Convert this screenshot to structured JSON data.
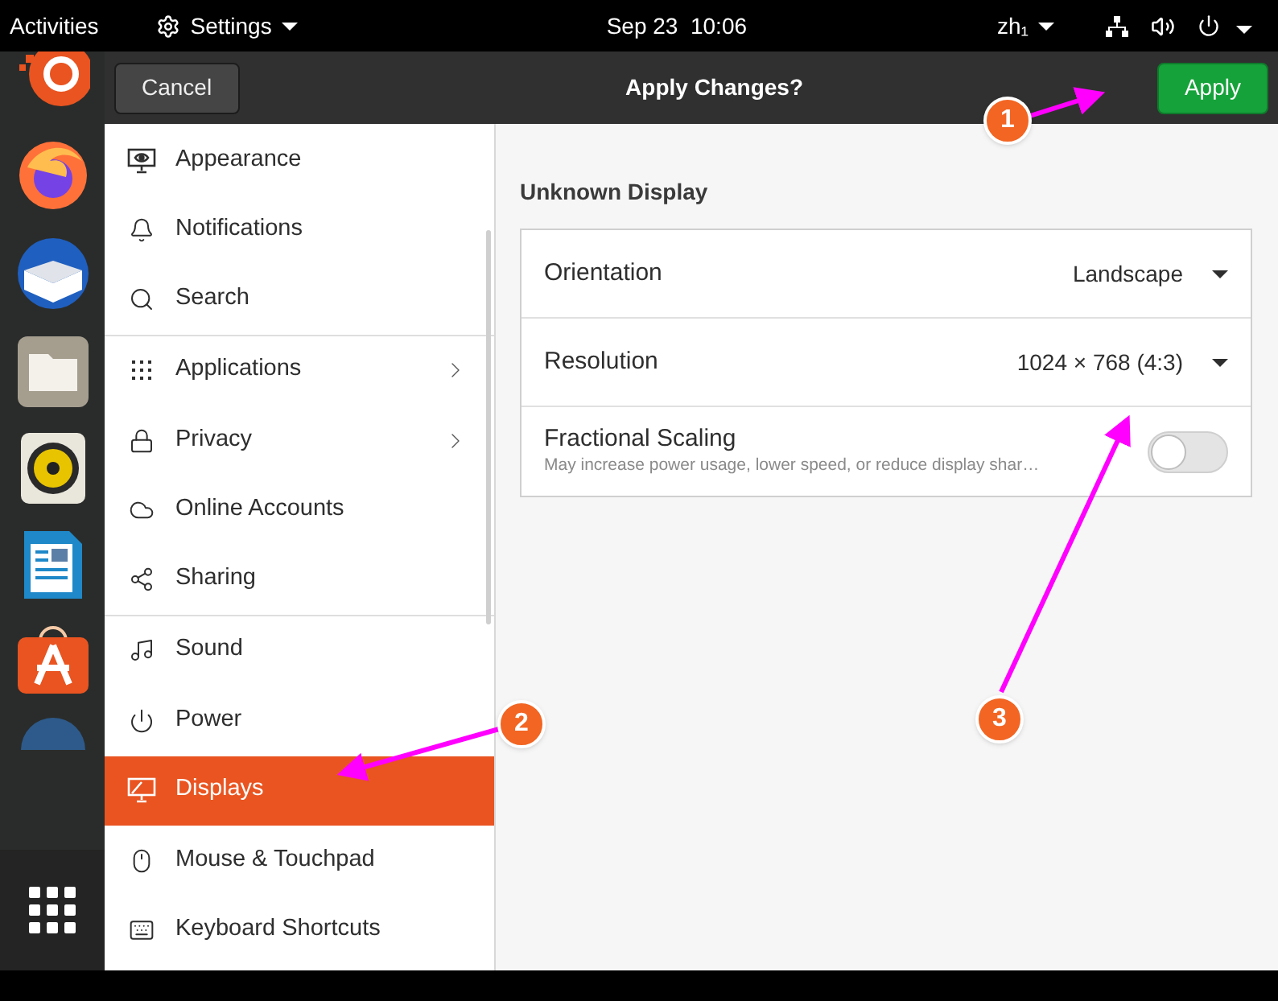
{
  "top_bar": {
    "activities": "Activities",
    "app_menu": "Settings",
    "clock": "Sep 23  10:06",
    "input_method": "zh₁"
  },
  "header": {
    "cancel": "Cancel",
    "title": "Apply Changes?",
    "apply": "Apply"
  },
  "sidebar": {
    "items": [
      {
        "label": "Appearance",
        "selected": false,
        "submenu": false,
        "divider_after": false
      },
      {
        "label": "Notifications",
        "selected": false,
        "submenu": false,
        "divider_after": false
      },
      {
        "label": "Search",
        "selected": false,
        "submenu": false,
        "divider_after": true
      },
      {
        "label": "Applications",
        "selected": false,
        "submenu": true,
        "divider_after": false
      },
      {
        "label": "Privacy",
        "selected": false,
        "submenu": true,
        "divider_after": false
      },
      {
        "label": "Online Accounts",
        "selected": false,
        "submenu": false,
        "divider_after": false
      },
      {
        "label": "Sharing",
        "selected": false,
        "submenu": false,
        "divider_after": true
      },
      {
        "label": "Sound",
        "selected": false,
        "submenu": false,
        "divider_after": false
      },
      {
        "label": "Power",
        "selected": false,
        "submenu": false,
        "divider_after": false
      },
      {
        "label": "Displays",
        "selected": true,
        "submenu": false,
        "divider_after": false
      },
      {
        "label": "Mouse & Touchpad",
        "selected": false,
        "submenu": false,
        "divider_after": false
      },
      {
        "label": "Keyboard Shortcuts",
        "selected": false,
        "submenu": false,
        "divider_after": false
      }
    ]
  },
  "display": {
    "heading": "Unknown Display",
    "rows": [
      {
        "kind": "dropdown",
        "label": "Orientation",
        "value": "Landscape"
      },
      {
        "kind": "dropdown",
        "label": "Resolution",
        "value": "1024 × 768 (4:3)"
      },
      {
        "kind": "switch",
        "label": "Fractional Scaling",
        "description": "May increase power usage, lower speed, or reduce display shar…",
        "on": false
      }
    ]
  },
  "annotations": [
    {
      "number": "1"
    },
    {
      "number": "2"
    },
    {
      "number": "3"
    }
  ]
}
